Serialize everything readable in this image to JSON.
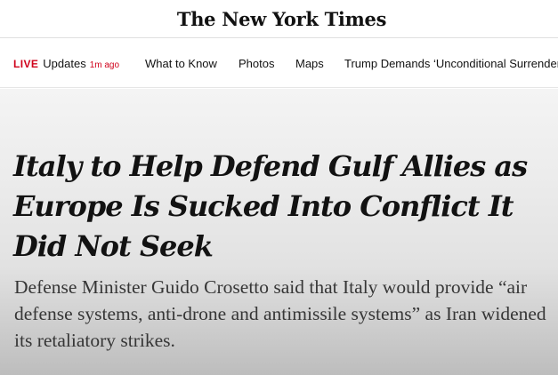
{
  "masthead": {
    "logo_text": "The New York Times"
  },
  "nav": {
    "live_label": "LIVE",
    "live_updates": "Updates",
    "timestamp": "1m ago",
    "items": [
      {
        "label": "What to Know"
      },
      {
        "label": "Photos"
      },
      {
        "label": "Maps"
      },
      {
        "label": "Trump Demands ‘Unconditional Surrender’"
      }
    ]
  },
  "article": {
    "headline": "Italy to Help Defend Gulf Allies as Europe Is Sucked Into Conflict It Did Not Seek",
    "summary": "Defense Minister Guido Crosetto said that Italy would provide “air defense systems, anti-drone and antimissile systems” as Iran widened its retaliatory strikes."
  },
  "colors": {
    "live_red": "#d0021b",
    "text_primary": "#121212",
    "summary_text": "#363636"
  }
}
